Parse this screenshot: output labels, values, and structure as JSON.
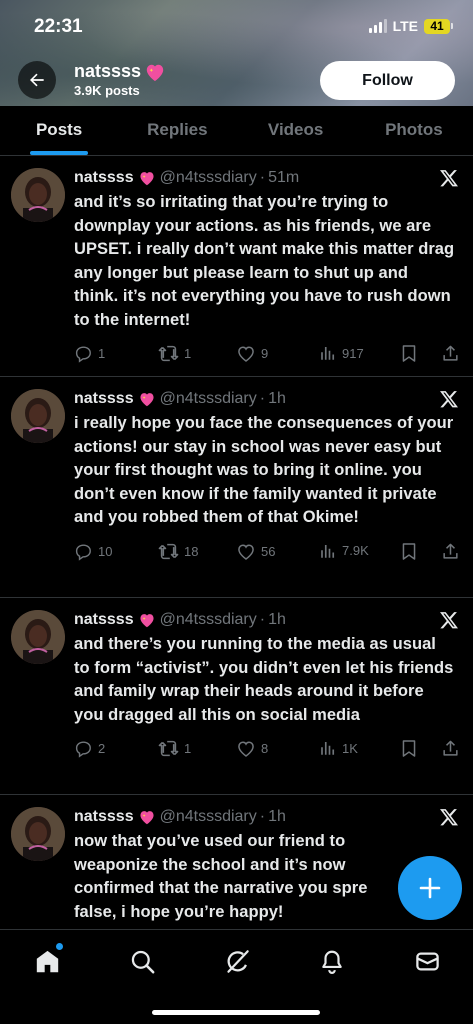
{
  "status": {
    "time": "22:31",
    "network": "LTE",
    "battery": "41"
  },
  "profile": {
    "name": "natssss",
    "posts": "3.9K posts",
    "follow_label": "Follow"
  },
  "tabs": [
    {
      "label": "Posts",
      "active": true
    },
    {
      "label": "Replies",
      "active": false
    },
    {
      "label": "Videos",
      "active": false
    },
    {
      "label": "Photos",
      "active": false
    }
  ],
  "tweets": [
    {
      "name": "natssss",
      "handle": "@n4tsssdiary",
      "time": "51m",
      "text": "and it’s so irritating that you’re trying to downplay your actions. as his friends, we are UPSET. i really don’t want make this matter drag any longer but please learn to shut up and think. it’s not everything you have to rush down to the internet!",
      "replies": "1",
      "reposts": "1",
      "likes": "9",
      "views": "917"
    },
    {
      "name": "natssss",
      "handle": "@n4tsssdiary",
      "time": "1h",
      "text": "i really hope you face the consequences of your actions! our stay in school was never easy but your first thought was to bring it online. you don’t even know if the family wanted it private and you robbed them of that Okime!",
      "replies": "10",
      "reposts": "18",
      "likes": "56",
      "views": "7.9K"
    },
    {
      "name": "natssss",
      "handle": "@n4tsssdiary",
      "time": "1h",
      "text": "and there’s you running to the media as usual to form “activist”. you didn’t even let his friends and family wrap their heads around it before you dragged all this on social media",
      "replies": "2",
      "reposts": "1",
      "likes": "8",
      "views": "1K"
    },
    {
      "name": "natssss",
      "handle": "@n4tsssdiary",
      "time": "1h",
      "text": "now that you’ve used our friend to weaponize the school and it’s now confirmed that the narrative you spre false, i hope you’re happy!",
      "replies": "",
      "reposts": "",
      "likes": "",
      "views": ""
    }
  ],
  "nav": [
    "home-icon",
    "search-icon",
    "grok-icon",
    "notifications-icon",
    "messages-icon"
  ],
  "colors": {
    "accent": "#1d9bf0",
    "text": "#e7e9ea",
    "muted": "#71767b",
    "heart": "#f04fa0"
  }
}
